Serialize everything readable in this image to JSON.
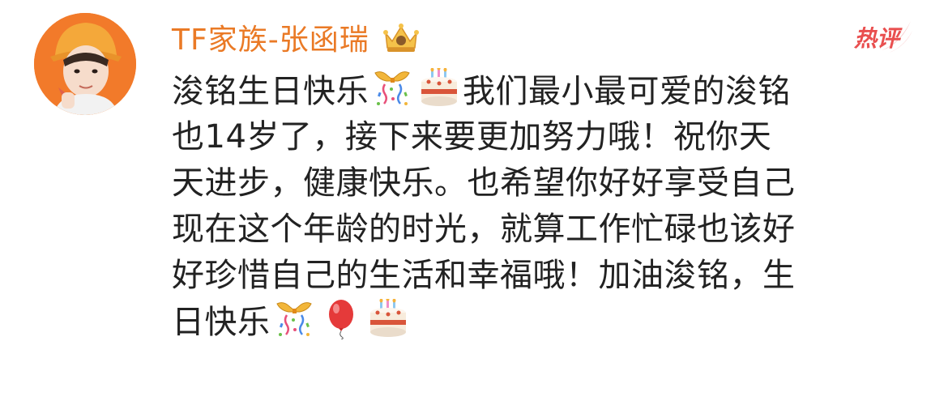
{
  "comment": {
    "username": "TF家族-张函瑞",
    "hot_label": "热评",
    "lines": [
      {
        "parts": [
          {
            "t": "text",
            "v": "浚铭生日快乐"
          },
          {
            "t": "emoji",
            "name": "confetti-gift-icon"
          },
          {
            "t": "emoji",
            "name": "birthday-cake-icon"
          },
          {
            "t": "text",
            "v": "我们最小最可爱的浚铭"
          }
        ]
      },
      {
        "parts": [
          {
            "t": "text",
            "v": "也14岁了，接下来要更加努力哦！祝你天"
          }
        ]
      },
      {
        "parts": [
          {
            "t": "text",
            "v": "天进步，健康快乐。也希望你好好享受自己"
          }
        ]
      },
      {
        "parts": [
          {
            "t": "text",
            "v": "现在这个年龄的时光，就算工作忙碌也该好"
          }
        ]
      },
      {
        "parts": [
          {
            "t": "text",
            "v": "好珍惜自己的生活和幸福哦！加油浚铭，生"
          }
        ]
      },
      {
        "parts": [
          {
            "t": "text",
            "v": "日快乐"
          },
          {
            "t": "emoji",
            "name": "confetti-gift-icon"
          },
          {
            "t": "emoji",
            "name": "red-balloon-icon"
          },
          {
            "t": "emoji",
            "name": "birthday-cake-icon"
          }
        ]
      }
    ]
  },
  "colors": {
    "username": "#ea7a26",
    "hot": "#e94f4f",
    "text": "#222222"
  }
}
